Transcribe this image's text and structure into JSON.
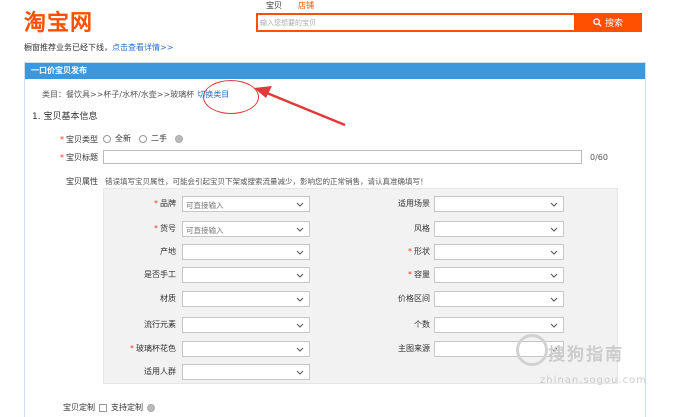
{
  "header": {
    "logo": "淘宝网",
    "search_tabs": [
      "宝贝",
      "店铺"
    ],
    "search_placeholder": "输入您想要的宝贝",
    "search_button": "搜索"
  },
  "notice": {
    "text": "橱窗推荐业务已经下线，",
    "link": "点击查看详情>>"
  },
  "panel": {
    "title": "一口价宝贝发布",
    "category_label": "类目：",
    "category_path": "餐饮具>>杯子/水杯/水壶>>玻璃杯",
    "switch_category": "切换类目",
    "section_title": "1. 宝贝基本信息"
  },
  "form": {
    "type_label": "宝贝类型",
    "type_options": [
      "全新",
      "二手",
      ""
    ],
    "title_label": "宝贝标题",
    "title_value": "",
    "title_counter": "0/60",
    "attr_label": "宝贝属性",
    "attr_hint": "错误填写宝贝属性，可能会引起宝贝下架或搜索流量减少，影响您的正常销售，请认真准确填写！",
    "attributes_left": [
      {
        "label": "品牌",
        "required": true,
        "value": "可直接输入"
      },
      {
        "label": "货号",
        "required": true,
        "value": "可直接输入"
      },
      {
        "label": "产地",
        "required": false,
        "value": ""
      },
      {
        "label": "是否手工",
        "required": false,
        "value": ""
      },
      {
        "label": "材质",
        "required": false,
        "value": ""
      },
      {
        "label": "流行元素",
        "required": false,
        "value": ""
      },
      {
        "label": "玻璃杯花色",
        "required": true,
        "value": ""
      },
      {
        "label": "适用人群",
        "required": false,
        "value": ""
      }
    ],
    "attributes_right": [
      {
        "label": "适用场景",
        "required": false,
        "value": ""
      },
      {
        "label": "风格",
        "required": false,
        "value": ""
      },
      {
        "label": "形状",
        "required": true,
        "value": ""
      },
      {
        "label": "容量",
        "required": true,
        "value": ""
      },
      {
        "label": "价格区间",
        "required": false,
        "value": ""
      },
      {
        "label": "个数",
        "required": false,
        "value": ""
      },
      {
        "label": "主图来源",
        "required": false,
        "value": ""
      }
    ],
    "custom_label": "宝贝定制",
    "custom_option": "支持定制"
  },
  "watermark": {
    "text": "搜狗指南",
    "url": "zhinan.sogou.com"
  },
  "colors": {
    "brand": "#ff5000",
    "header_blue": "#3c97dd",
    "link_blue": "#2b6fc6",
    "required_red": "#ff3b1f",
    "annotation_red": "#e03a3a"
  }
}
